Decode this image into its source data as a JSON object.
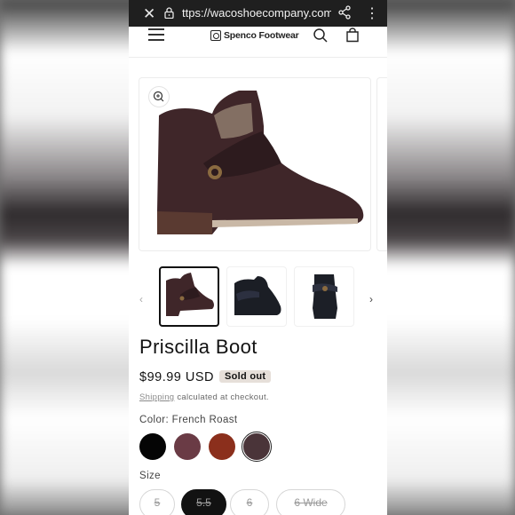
{
  "browser": {
    "url": "ttps://wacoshoecompany.com/p"
  },
  "header": {
    "brand": "Spenco Footwear"
  },
  "product": {
    "title": "Priscilla Boot",
    "price": "$99.99 USD",
    "badge": "Sold out",
    "shipping_link": "Shipping",
    "shipping_text": " calculated at checkout."
  },
  "colors": {
    "label": "Color: French Roast",
    "swatches": [
      {
        "hex": "#050505"
      },
      {
        "hex": "#6a3b45"
      },
      {
        "hex": "#8b2f1c"
      },
      {
        "hex": "#4a3439"
      }
    ],
    "selected_index": 3
  },
  "sizes": {
    "label": "Size",
    "options": [
      "5",
      "5.5",
      "6",
      "6 Wide"
    ],
    "selected_index": 1
  }
}
